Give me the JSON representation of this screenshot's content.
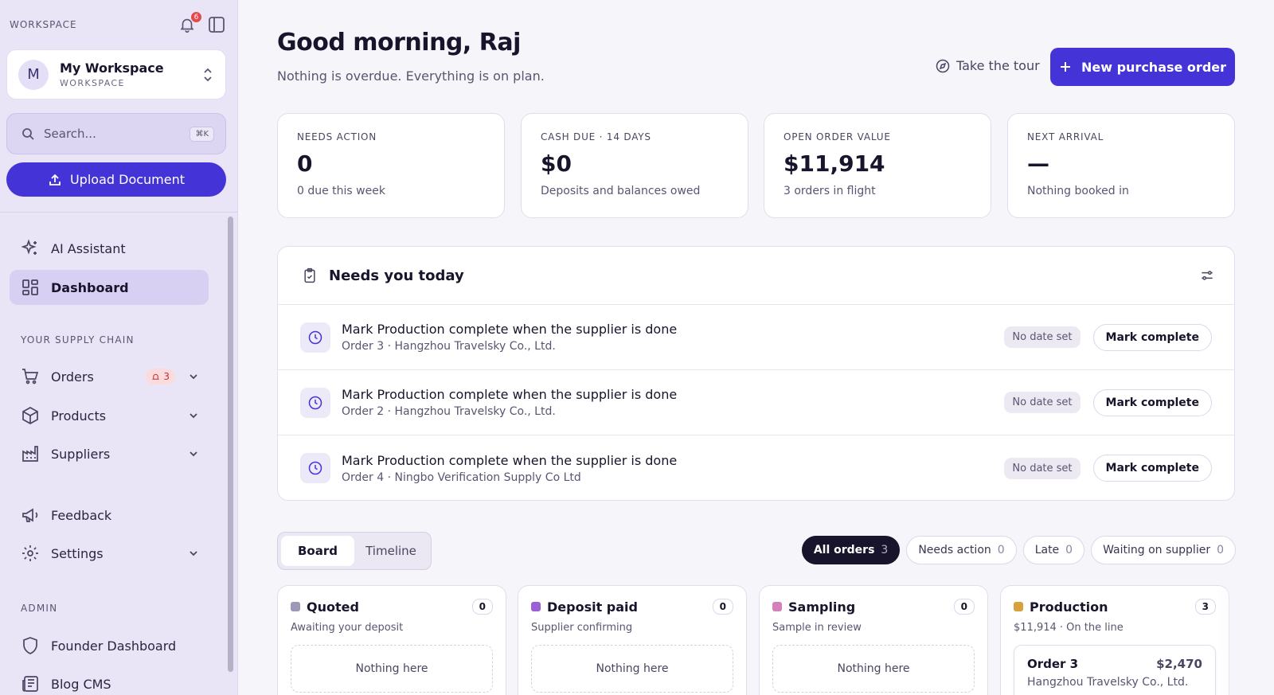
{
  "sidebar": {
    "workspace_label": "WORKSPACE",
    "notification_count": "6",
    "workspace": {
      "initial": "M",
      "name": "My Workspace",
      "sub": "WORKSPACE"
    },
    "search": {
      "placeholder": "Search...",
      "shortcut": "⌘K"
    },
    "upload_label": "Upload Document",
    "items_top": [
      {
        "label": "AI Assistant",
        "icon": "sparkle-icon"
      },
      {
        "label": "Dashboard",
        "icon": "grid-icon",
        "active": true
      }
    ],
    "supply_chain_label": "YOUR SUPPLY CHAIN",
    "orders": {
      "label": "Orders",
      "alert_count": "3"
    },
    "products_label": "Products",
    "suppliers_label": "Suppliers",
    "feedback_label": "Feedback",
    "settings_label": "Settings",
    "admin_label": "ADMIN",
    "founder_label": "Founder Dashboard",
    "blog_label": "Blog CMS"
  },
  "header": {
    "greeting": "Good morning, Raj",
    "subtitle": "Nothing is overdue. Everything is on plan.",
    "tour_label": "Take the tour",
    "new_po_label": "New purchase order"
  },
  "stats": [
    {
      "label": "NEEDS ACTION",
      "value": "0",
      "sub": "0 due this week"
    },
    {
      "label": "CASH DUE · 14 DAYS",
      "value": "$0",
      "sub": "Deposits and balances owed"
    },
    {
      "label": "OPEN ORDER VALUE",
      "value": "$11,914",
      "sub": "3 orders in flight"
    },
    {
      "label": "NEXT ARRIVAL",
      "value": "—",
      "sub": "Nothing booked in"
    }
  ],
  "today": {
    "title": "Needs you today",
    "tasks": [
      {
        "title": "Mark Production complete when the supplier is done",
        "sub": "Order 3 · Hangzhou Travelsky Co., Ltd.",
        "date": "No date set",
        "action": "Mark complete"
      },
      {
        "title": "Mark Production complete when the supplier is done",
        "sub": "Order 2 · Hangzhou Travelsky Co., Ltd.",
        "date": "No date set",
        "action": "Mark complete"
      },
      {
        "title": "Mark Production complete when the supplier is done",
        "sub": "Order 4 · Ningbo Verification Supply Co Ltd",
        "date": "No date set",
        "action": "Mark complete"
      }
    ]
  },
  "view_toggle": {
    "board": "Board",
    "timeline": "Timeline"
  },
  "filters": [
    {
      "label": "All orders",
      "count": "3",
      "active": true
    },
    {
      "label": "Needs action",
      "count": "0"
    },
    {
      "label": "Late",
      "count": "0"
    },
    {
      "label": "Waiting on supplier",
      "count": "0"
    }
  ],
  "columns": [
    {
      "title": "Quoted",
      "count": "0",
      "sub": "Awaiting your deposit",
      "color": "#9b98b8",
      "empty": "Nothing here"
    },
    {
      "title": "Deposit paid",
      "count": "0",
      "sub": "Supplier confirming",
      "color": "#9b5fd6",
      "empty": "Nothing here"
    },
    {
      "title": "Sampling",
      "count": "0",
      "sub": "Sample in review",
      "color": "#d77fb9",
      "empty": "Nothing here"
    },
    {
      "title": "Production",
      "count": "3",
      "sub": "$11,914 · On the line",
      "color": "#d9a03f",
      "card": {
        "order": "Order 3",
        "amount": "$2,470",
        "supplier": "Hangzhou Travelsky Co., Ltd."
      }
    }
  ]
}
